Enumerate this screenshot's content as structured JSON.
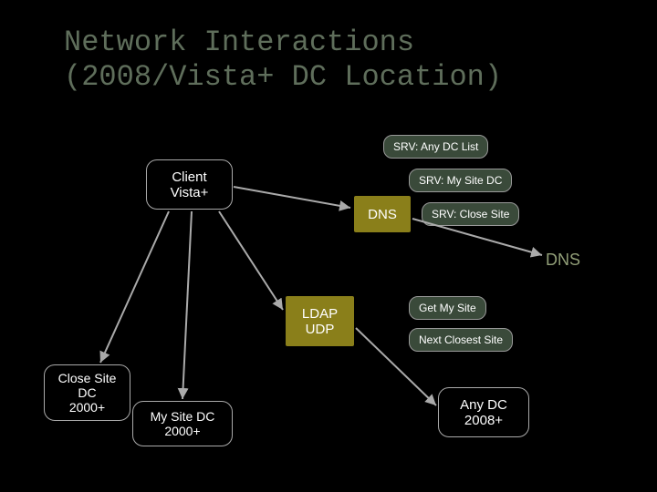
{
  "title_line1": "Network Interactions",
  "title_line2": "(2008/Vista+ DC Location)",
  "client": {
    "line1": "Client",
    "line2": "Vista+"
  },
  "dns_box": "DNS",
  "ldap_box": {
    "line1": "LDAP",
    "line2": "UDP"
  },
  "close_site_dc": {
    "line1": "Close Site",
    "line2": "DC",
    "line3": "2000+"
  },
  "my_site_dc": {
    "line1": "My Site DC",
    "line2": "2000+"
  },
  "any_dc": {
    "line1": "Any DC",
    "line2": "2008+"
  },
  "tags": {
    "srv_any": "SRV: Any DC List",
    "srv_mysite": "SRV: My Site DC",
    "srv_close": "SRV: Close Site",
    "get_mysite": "Get My Site",
    "next_closest": "Next Closest Site"
  },
  "dns_label": "DNS"
}
